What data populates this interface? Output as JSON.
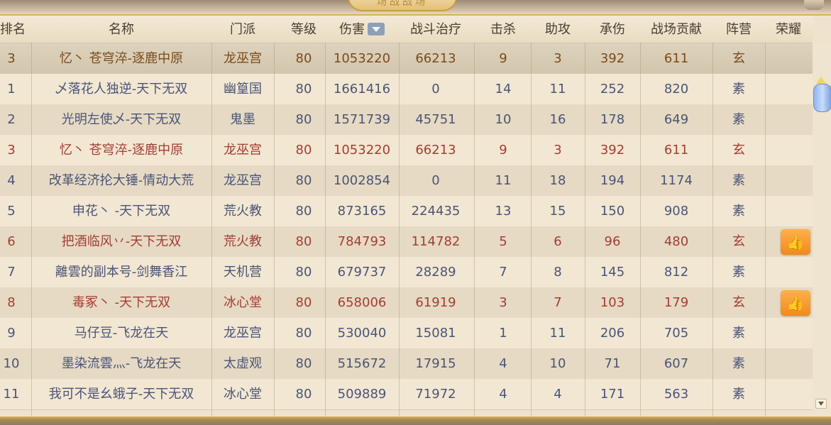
{
  "banner": {
    "title": "场战战场"
  },
  "columns": [
    "排名",
    "名称",
    "门派",
    "等级",
    "伤害",
    "战斗治疗",
    "击杀",
    "助攻",
    "承伤",
    "战场贡献",
    "阵营",
    "荣耀"
  ],
  "sort_column": "伤害",
  "my_row": {
    "rank": "3",
    "name": "忆丶 苍穹淬-逐鹿中原",
    "school": "龙巫宫",
    "level": "80",
    "damage": "1053220",
    "heal": "66213",
    "kills": "9",
    "assists": "3",
    "taken": "392",
    "contribution": "611",
    "camp": "玄",
    "honor": false
  },
  "rows": [
    {
      "rank": "1",
      "name": "乄落花人独逆-天下无双",
      "school": "幽篁国",
      "level": "80",
      "damage": "1661416",
      "heal": "0",
      "kills": "14",
      "assists": "11",
      "taken": "252",
      "contribution": "820",
      "camp": "素",
      "honor": false
    },
    {
      "rank": "2",
      "name": "光明左使乄-天下无双",
      "school": "鬼墨",
      "level": "80",
      "damage": "1571739",
      "heal": "45751",
      "kills": "10",
      "assists": "16",
      "taken": "178",
      "contribution": "649",
      "camp": "素",
      "honor": false
    },
    {
      "rank": "3",
      "name": "忆丶 苍穹淬-逐鹿中原",
      "school": "龙巫宫",
      "level": "80",
      "damage": "1053220",
      "heal": "66213",
      "kills": "9",
      "assists": "3",
      "taken": "392",
      "contribution": "611",
      "camp": "玄",
      "honor": false
    },
    {
      "rank": "4",
      "name": "改革经济抡大锤-情动大荒",
      "school": "龙巫宫",
      "level": "80",
      "damage": "1002854",
      "heal": "0",
      "kills": "11",
      "assists": "18",
      "taken": "194",
      "contribution": "1174",
      "camp": "素",
      "honor": false
    },
    {
      "rank": "5",
      "name": "申花丶 -天下无双",
      "school": "荒火教",
      "level": "80",
      "damage": "873165",
      "heal": "224435",
      "kills": "13",
      "assists": "15",
      "taken": "150",
      "contribution": "908",
      "camp": "素",
      "honor": false
    },
    {
      "rank": "6",
      "name": "把酒临风丷-天下无双",
      "school": "荒火教",
      "level": "80",
      "damage": "784793",
      "heal": "114782",
      "kills": "5",
      "assists": "6",
      "taken": "96",
      "contribution": "480",
      "camp": "玄",
      "honor": true
    },
    {
      "rank": "7",
      "name": "離雲的副本号-剑舞香江",
      "school": "天机营",
      "level": "80",
      "damage": "679737",
      "heal": "28289",
      "kills": "7",
      "assists": "8",
      "taken": "145",
      "contribution": "812",
      "camp": "素",
      "honor": false
    },
    {
      "rank": "8",
      "name": "毒冢丶 -天下无双",
      "school": "冰心堂",
      "level": "80",
      "damage": "658006",
      "heal": "61919",
      "kills": "3",
      "assists": "7",
      "taken": "103",
      "contribution": "179",
      "camp": "玄",
      "honor": true
    },
    {
      "rank": "9",
      "name": "马仔豆-飞龙在天",
      "school": "龙巫宫",
      "level": "80",
      "damage": "530040",
      "heal": "15081",
      "kills": "1",
      "assists": "11",
      "taken": "206",
      "contribution": "705",
      "camp": "素",
      "honor": false
    },
    {
      "rank": "10",
      "name": "墨染流雲灬-飞龙在天",
      "school": "太虚观",
      "level": "80",
      "damage": "515672",
      "heal": "17915",
      "kills": "4",
      "assists": "10",
      "taken": "71",
      "contribution": "607",
      "camp": "素",
      "honor": false
    },
    {
      "rank": "11",
      "name": "我可不是幺蛾子-天下无双",
      "school": "冰心堂",
      "level": "80",
      "damage": "509889",
      "heal": "71972",
      "kills": "4",
      "assists": "4",
      "taken": "171",
      "contribution": "563",
      "camp": "素",
      "honor": false
    }
  ],
  "colors": {
    "camp_xuan_text": "#a23d35",
    "camp_su_text": "#4a5478",
    "my_row_text": "#7a4b1a",
    "honor_button": "#f08a1c",
    "scroll_thumb": "#a9c7f5"
  },
  "icons": {
    "sort": "sort-desc-icon",
    "honor": "thumbs-up-icon",
    "scroll": "scroll-thumb"
  }
}
